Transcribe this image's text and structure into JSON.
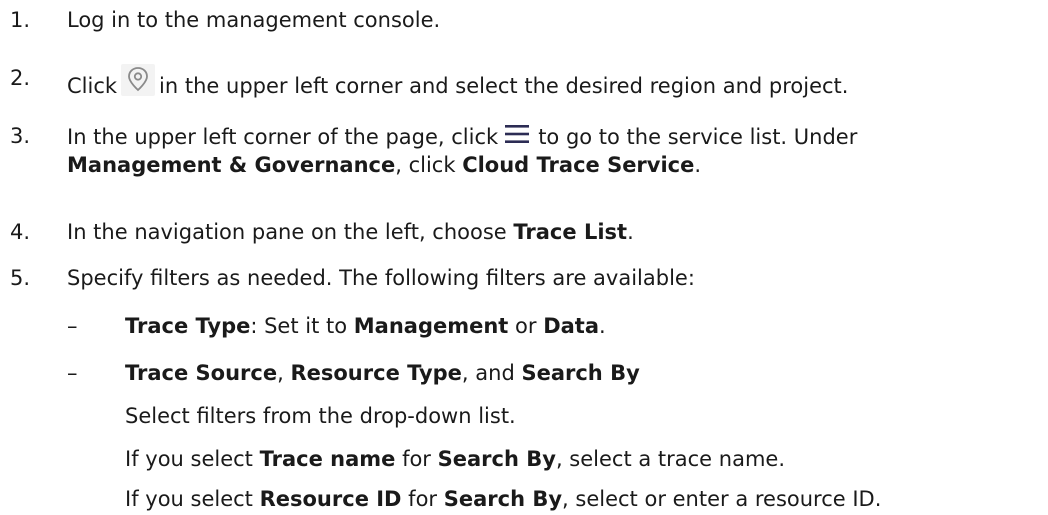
{
  "steps": [
    {
      "number": "1.",
      "text": "Log in to the management console."
    },
    {
      "number": "2.",
      "before": "Click",
      "icon": "location-pin-icon",
      "after": "in the upper left corner and select the desired region and project."
    },
    {
      "number": "3.",
      "before": "In the upper left corner of the page, click",
      "icon": "hamburger-menu-icon",
      "after": "to go to the service list. Under",
      "bold1": "Management & Governance",
      "mid": ", click ",
      "bold2": "Cloud Trace Service",
      "end": "."
    },
    {
      "number": "4.",
      "text": "In the navigation pane on the left, choose ",
      "bold": "Trace List",
      "end": "."
    },
    {
      "number": "5.",
      "text": "Specify filters as needed. The following filters are available:"
    }
  ],
  "filters": [
    {
      "dash": "–",
      "bold": "Trace Type",
      "text1": ": Set it to ",
      "bold2": "Management",
      "text2": " or ",
      "bold3": "Data",
      "end": "."
    },
    {
      "dash": "–",
      "bold": "Trace Source",
      "text1": ", ",
      "bold2": "Resource Type",
      "text2": ", and ",
      "bold3": "Search By",
      "end": ""
    }
  ],
  "notes": {
    "line1": "Select filters from the drop-down list.",
    "line2": {
      "a": "If you select ",
      "b": "Trace name",
      "c": " for ",
      "d": "Search By",
      "e": ", select a trace name."
    },
    "line3": {
      "a": "If you select ",
      "b": "Resource ID",
      "c": " for ",
      "d": "Search By",
      "e": ", select or enter a resource ID."
    }
  }
}
